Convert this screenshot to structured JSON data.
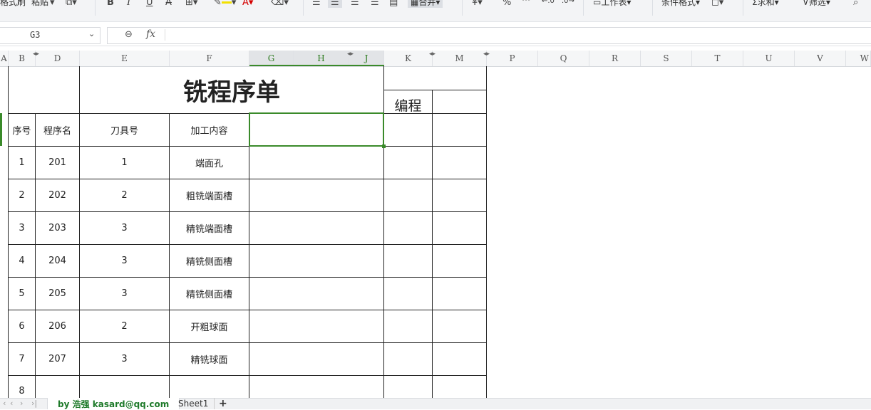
{
  "ribbon": {
    "format_painter": "格式刷",
    "paste": "粘贴",
    "merge": "合并",
    "worksheet": "工作表",
    "conditional_format": "条件格式",
    "sum": "求和",
    "filter": "筛选",
    "bold": "B",
    "italic": "I",
    "underline": "U",
    "percent": "%",
    "fill_color": "#f2e000",
    "font_color": "#d40000"
  },
  "formula_bar": {
    "cell_ref": "G3",
    "fx": "fx",
    "value": ""
  },
  "columns": [
    "A",
    "B",
    "D",
    "E",
    "F",
    "G",
    "H",
    "J",
    "K",
    "M",
    "P",
    "Q",
    "R",
    "S",
    "T",
    "U",
    "V",
    "W"
  ],
  "sheet": {
    "title": "铣程序单",
    "programming": "编程",
    "headers": [
      "序号",
      "程序名",
      "刀具号",
      "加工内容"
    ],
    "rows": [
      {
        "no": "1",
        "program": "201",
        "tool": "1",
        "content": "端面孔"
      },
      {
        "no": "2",
        "program": "202",
        "tool": "2",
        "content": "粗铣端面槽"
      },
      {
        "no": "3",
        "program": "203",
        "tool": "3",
        "content": "精铣端面槽"
      },
      {
        "no": "4",
        "program": "204",
        "tool": "3",
        "content": "精铣侧面槽"
      },
      {
        "no": "5",
        "program": "205",
        "tool": "3",
        "content": "精铣侧面槽"
      },
      {
        "no": "6",
        "program": "206",
        "tool": "2",
        "content": "开粗球面"
      },
      {
        "no": "7",
        "program": "207",
        "tool": "3",
        "content": "精铣球面"
      },
      {
        "no": "8",
        "program": "",
        "tool": "",
        "content": ""
      }
    ]
  },
  "tabs": {
    "active": "by 浩强 kasard@qq.com",
    "other": "Sheet1",
    "add": "+"
  },
  "colors": {
    "selection": "#3a8a2a",
    "active_tab_text": "#1e7a2a"
  }
}
